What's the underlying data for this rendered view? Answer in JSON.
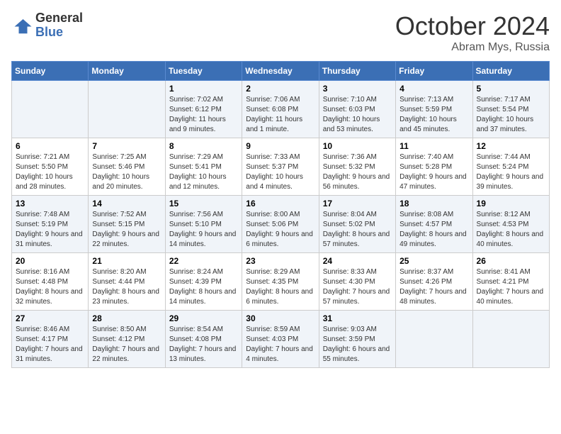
{
  "logo": {
    "line1": "General",
    "line2": "Blue"
  },
  "title": "October 2024",
  "subtitle": "Abram Mys, Russia",
  "days_of_week": [
    "Sunday",
    "Monday",
    "Tuesday",
    "Wednesday",
    "Thursday",
    "Friday",
    "Saturday"
  ],
  "weeks": [
    [
      {
        "day": "",
        "info": ""
      },
      {
        "day": "",
        "info": ""
      },
      {
        "day": "1",
        "info": "Sunrise: 7:02 AM\nSunset: 6:12 PM\nDaylight: 11 hours\nand 9 minutes."
      },
      {
        "day": "2",
        "info": "Sunrise: 7:06 AM\nSunset: 6:08 PM\nDaylight: 11 hours\nand 1 minute."
      },
      {
        "day": "3",
        "info": "Sunrise: 7:10 AM\nSunset: 6:03 PM\nDaylight: 10 hours\nand 53 minutes."
      },
      {
        "day": "4",
        "info": "Sunrise: 7:13 AM\nSunset: 5:59 PM\nDaylight: 10 hours\nand 45 minutes."
      },
      {
        "day": "5",
        "info": "Sunrise: 7:17 AM\nSunset: 5:54 PM\nDaylight: 10 hours\nand 37 minutes."
      }
    ],
    [
      {
        "day": "6",
        "info": "Sunrise: 7:21 AM\nSunset: 5:50 PM\nDaylight: 10 hours\nand 28 minutes."
      },
      {
        "day": "7",
        "info": "Sunrise: 7:25 AM\nSunset: 5:46 PM\nDaylight: 10 hours\nand 20 minutes."
      },
      {
        "day": "8",
        "info": "Sunrise: 7:29 AM\nSunset: 5:41 PM\nDaylight: 10 hours\nand 12 minutes."
      },
      {
        "day": "9",
        "info": "Sunrise: 7:33 AM\nSunset: 5:37 PM\nDaylight: 10 hours\nand 4 minutes."
      },
      {
        "day": "10",
        "info": "Sunrise: 7:36 AM\nSunset: 5:32 PM\nDaylight: 9 hours\nand 56 minutes."
      },
      {
        "day": "11",
        "info": "Sunrise: 7:40 AM\nSunset: 5:28 PM\nDaylight: 9 hours\nand 47 minutes."
      },
      {
        "day": "12",
        "info": "Sunrise: 7:44 AM\nSunset: 5:24 PM\nDaylight: 9 hours\nand 39 minutes."
      }
    ],
    [
      {
        "day": "13",
        "info": "Sunrise: 7:48 AM\nSunset: 5:19 PM\nDaylight: 9 hours\nand 31 minutes."
      },
      {
        "day": "14",
        "info": "Sunrise: 7:52 AM\nSunset: 5:15 PM\nDaylight: 9 hours\nand 22 minutes."
      },
      {
        "day": "15",
        "info": "Sunrise: 7:56 AM\nSunset: 5:10 PM\nDaylight: 9 hours\nand 14 minutes."
      },
      {
        "day": "16",
        "info": "Sunrise: 8:00 AM\nSunset: 5:06 PM\nDaylight: 9 hours\nand 6 minutes."
      },
      {
        "day": "17",
        "info": "Sunrise: 8:04 AM\nSunset: 5:02 PM\nDaylight: 8 hours\nand 57 minutes."
      },
      {
        "day": "18",
        "info": "Sunrise: 8:08 AM\nSunset: 4:57 PM\nDaylight: 8 hours\nand 49 minutes."
      },
      {
        "day": "19",
        "info": "Sunrise: 8:12 AM\nSunset: 4:53 PM\nDaylight: 8 hours\nand 40 minutes."
      }
    ],
    [
      {
        "day": "20",
        "info": "Sunrise: 8:16 AM\nSunset: 4:48 PM\nDaylight: 8 hours\nand 32 minutes."
      },
      {
        "day": "21",
        "info": "Sunrise: 8:20 AM\nSunset: 4:44 PM\nDaylight: 8 hours\nand 23 minutes."
      },
      {
        "day": "22",
        "info": "Sunrise: 8:24 AM\nSunset: 4:39 PM\nDaylight: 8 hours\nand 14 minutes."
      },
      {
        "day": "23",
        "info": "Sunrise: 8:29 AM\nSunset: 4:35 PM\nDaylight: 8 hours\nand 6 minutes."
      },
      {
        "day": "24",
        "info": "Sunrise: 8:33 AM\nSunset: 4:30 PM\nDaylight: 7 hours\nand 57 minutes."
      },
      {
        "day": "25",
        "info": "Sunrise: 8:37 AM\nSunset: 4:26 PM\nDaylight: 7 hours\nand 48 minutes."
      },
      {
        "day": "26",
        "info": "Sunrise: 8:41 AM\nSunset: 4:21 PM\nDaylight: 7 hours\nand 40 minutes."
      }
    ],
    [
      {
        "day": "27",
        "info": "Sunrise: 8:46 AM\nSunset: 4:17 PM\nDaylight: 7 hours\nand 31 minutes."
      },
      {
        "day": "28",
        "info": "Sunrise: 8:50 AM\nSunset: 4:12 PM\nDaylight: 7 hours\nand 22 minutes."
      },
      {
        "day": "29",
        "info": "Sunrise: 8:54 AM\nSunset: 4:08 PM\nDaylight: 7 hours\nand 13 minutes."
      },
      {
        "day": "30",
        "info": "Sunrise: 8:59 AM\nSunset: 4:03 PM\nDaylight: 7 hours\nand 4 minutes."
      },
      {
        "day": "31",
        "info": "Sunrise: 9:03 AM\nSunset: 3:59 PM\nDaylight: 6 hours\nand 55 minutes."
      },
      {
        "day": "",
        "info": ""
      },
      {
        "day": "",
        "info": ""
      }
    ]
  ]
}
